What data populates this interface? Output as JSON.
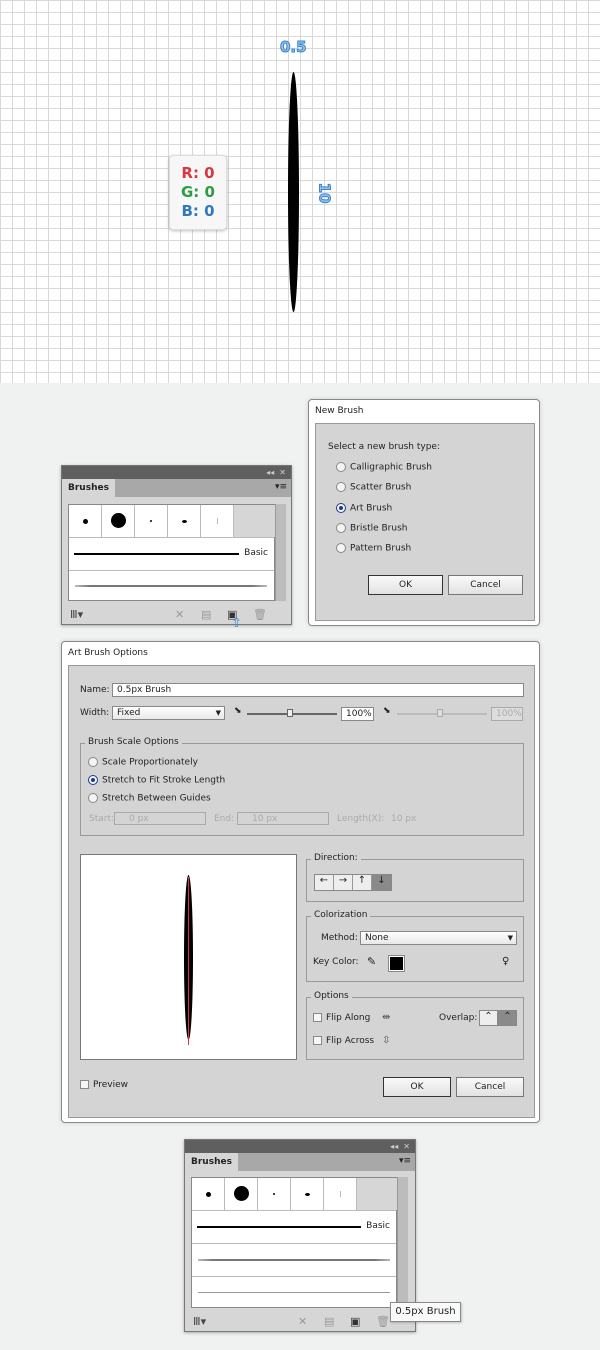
{
  "artboard": {
    "width_label": "0.5",
    "height_label": "10",
    "color": {
      "r_label": "R: 0",
      "g_label": "G: 0",
      "b_label": "B: 0",
      "r_color": "#d9363e",
      "g_color": "#2e9a4a",
      "b_color": "#2f79c0"
    },
    "shape_color": "#000000"
  },
  "new_brush": {
    "title": "New Brush",
    "prompt": "Select a new brush type:",
    "options": [
      "Calligraphic Brush",
      "Scatter Brush",
      "Art Brush",
      "Bristle Brush",
      "Pattern Brush"
    ],
    "selected": "Art Brush",
    "ok": "OK",
    "cancel": "Cancel"
  },
  "brushes_panel_1": {
    "tab": "Brushes",
    "basic_label": "Basic",
    "icons": [
      "brush-libraries-icon",
      "remove-stroke-icon",
      "options-icon",
      "new-brush-icon",
      "delete-icon"
    ]
  },
  "art_brush_options": {
    "title": "Art Brush Options",
    "name_label": "Name:",
    "name_value": "0.5px Brush",
    "width_label": "Width:",
    "width_value": "Fixed",
    "width_pct": "100%",
    "width_pct_2": "100%",
    "scale_group": "Brush Scale Options",
    "scale_options": [
      "Scale Proportionately",
      "Stretch to Fit Stroke Length",
      "Stretch Between Guides"
    ],
    "scale_selected": "Stretch to Fit Stroke Length",
    "start_label": "Start:",
    "start_value": "0 px",
    "end_label": "End:",
    "end_value": "10 px",
    "length_label": "Length(X):",
    "length_value": "10 px",
    "direction_group": "Direction:",
    "direction_selected": "down",
    "colorization_group": "Colorization",
    "method_label": "Method:",
    "method_value": "None",
    "key_color_label": "Key Color:",
    "key_color": "#000000",
    "options_group": "Options",
    "flip_along": "Flip Along",
    "flip_across": "Flip Across",
    "overlap_label": "Overlap:",
    "preview_label": "Preview",
    "ok": "OK",
    "cancel": "Cancel"
  },
  "brushes_panel_2": {
    "tab": "Brushes",
    "basic_label": "Basic",
    "tooltip": "0.5px Brush"
  }
}
